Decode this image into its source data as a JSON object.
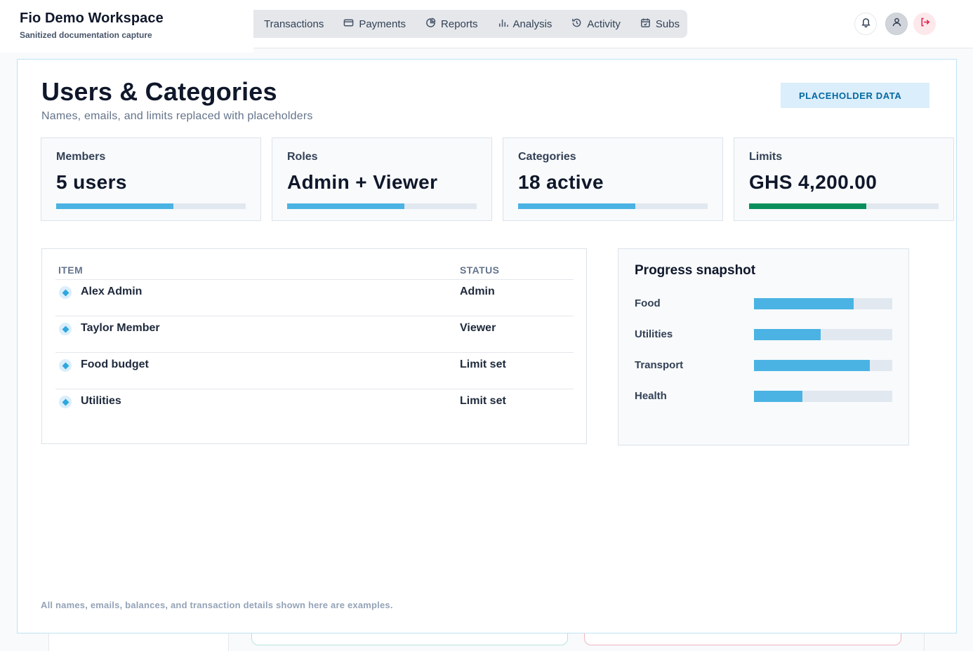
{
  "brand": {
    "title": "Fio Demo Workspace",
    "subtitle": "Sanitized documentation capture"
  },
  "nav": {
    "items": [
      {
        "label": "Transactions",
        "icon": "list-icon"
      },
      {
        "label": "Payments",
        "icon": "credit-card-icon"
      },
      {
        "label": "Reports",
        "icon": "pie-chart-icon"
      },
      {
        "label": "Analysis",
        "icon": "bar-chart-icon"
      },
      {
        "label": "Activity",
        "icon": "history-icon"
      },
      {
        "label": "Subs",
        "icon": "calendar-icon"
      }
    ]
  },
  "header_actions": {
    "icons": [
      "bell-icon",
      "user-icon",
      "logout-icon"
    ],
    "logout_color": "#e11d48"
  },
  "page": {
    "title": "Users & Categories",
    "subtitle": "Names, emails, and limits replaced with placeholders",
    "badge": "PLACEHOLDER DATA"
  },
  "stats": [
    {
      "label": "Members",
      "value": "5 users",
      "progress": 0.62,
      "color": "#4ab3e3"
    },
    {
      "label": "Roles",
      "value": "Admin + Viewer",
      "progress": 0.62,
      "color": "#4ab3e3"
    },
    {
      "label": "Categories",
      "value": "18 active",
      "progress": 0.62,
      "color": "#4ab3e3"
    },
    {
      "label": "Limits",
      "value": "GHS 4,200.00",
      "progress": 0.62,
      "color": "#0a8f5c"
    }
  ],
  "table": {
    "columns": [
      "ITEM",
      "STATUS"
    ],
    "rows": [
      {
        "name": "Alex Admin",
        "status": "Admin"
      },
      {
        "name": "Taylor Member",
        "status": "Viewer"
      },
      {
        "name": "Food budget",
        "status": "Limit set"
      },
      {
        "name": "Utilities",
        "status": "Limit set"
      }
    ]
  },
  "snapshot": {
    "title": "Progress snapshot",
    "items": [
      {
        "label": "Food",
        "progress": 0.72
      },
      {
        "label": "Utilities",
        "progress": 0.48
      },
      {
        "label": "Transport",
        "progress": 0.84
      },
      {
        "label": "Health",
        "progress": 0.35
      }
    ]
  },
  "footnote": "All names, emails, balances, and transaction details shown here are examples."
}
